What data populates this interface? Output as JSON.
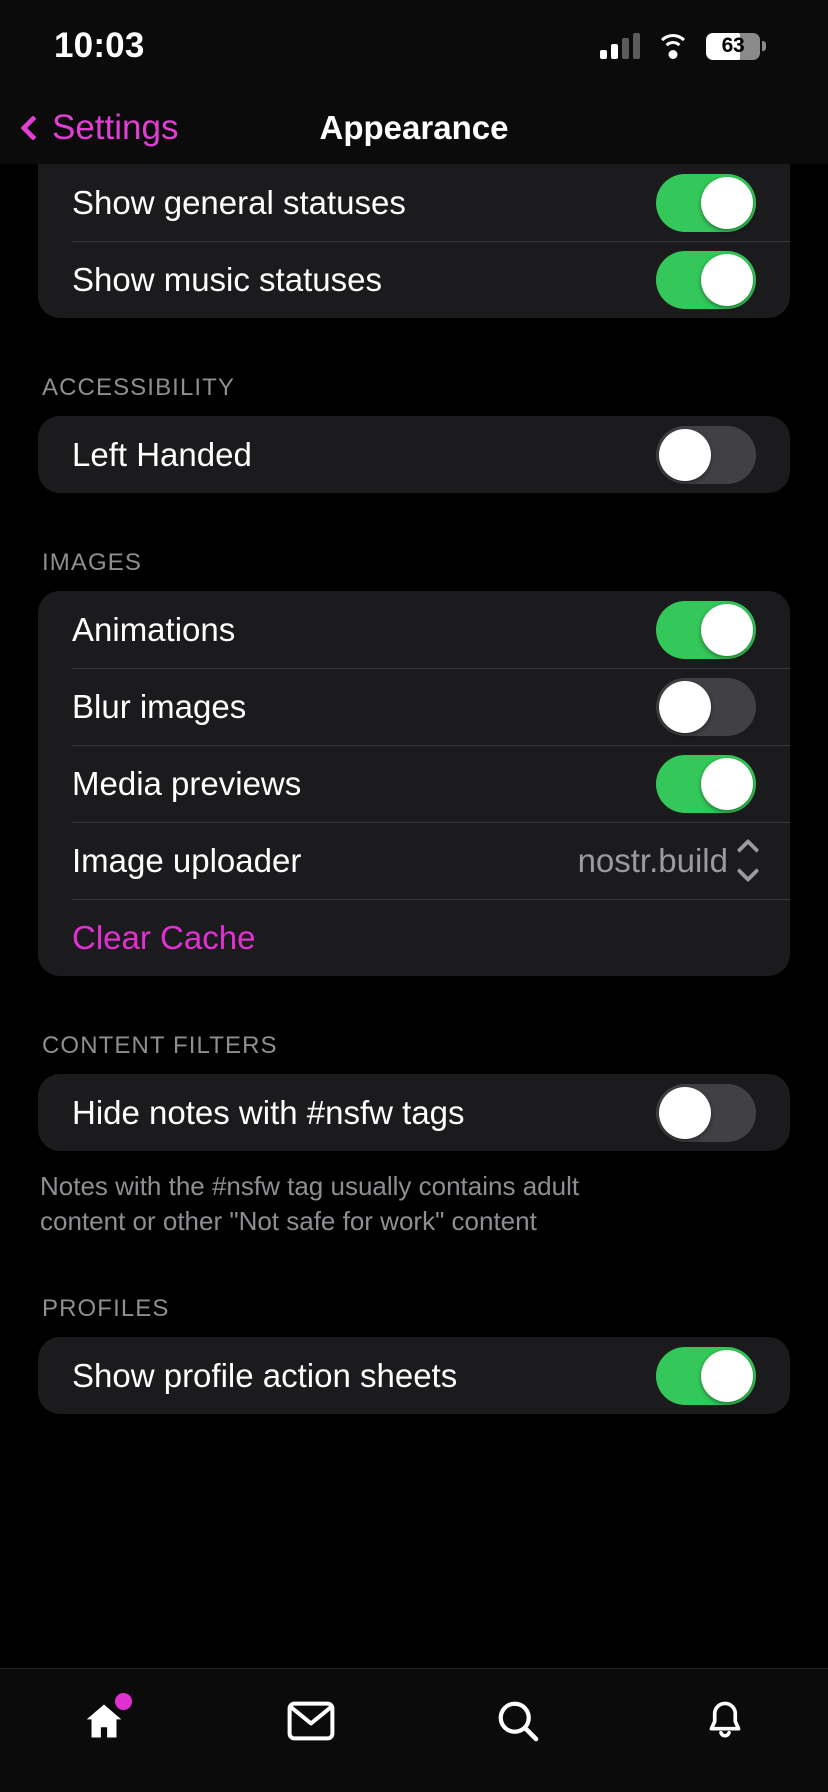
{
  "status_bar": {
    "time": "10:03",
    "battery_percent": "63",
    "battery_level": 63,
    "signal_icon": "cellular-bars-icon",
    "wifi_icon": "wifi-icon",
    "battery_icon": "battery-icon"
  },
  "nav": {
    "back_label": "Settings",
    "back_icon": "chevron-left-icon",
    "title": "Appearance"
  },
  "colors": {
    "accent": "#e130d2",
    "switch_on": "#34c759",
    "switch_off": "#414145",
    "card": "#1b1b1d",
    "background": "#000000",
    "secondary_text": "#8e8e93"
  },
  "sections": [
    {
      "header": "",
      "clipped": true,
      "rows": [
        {
          "label": "Show general statuses",
          "control": "switch",
          "value": "on"
        },
        {
          "label": "Show music statuses",
          "control": "switch",
          "value": "on"
        }
      ],
      "footnote": ""
    },
    {
      "header": "ACCESSIBILITY",
      "clipped": false,
      "rows": [
        {
          "label": "Left Handed",
          "control": "switch",
          "value": "off"
        }
      ],
      "footnote": ""
    },
    {
      "header": "IMAGES",
      "clipped": false,
      "rows": [
        {
          "label": "Animations",
          "control": "switch",
          "value": "on"
        },
        {
          "label": "Blur images",
          "control": "switch",
          "value": "off"
        },
        {
          "label": "Media previews",
          "control": "switch",
          "value": "on"
        },
        {
          "label": "Image uploader",
          "control": "picker",
          "value": "nostr.build"
        },
        {
          "label": "Clear Cache",
          "control": "none",
          "value": "",
          "accent": true
        }
      ],
      "footnote": ""
    },
    {
      "header": "CONTENT FILTERS",
      "clipped": false,
      "rows": [
        {
          "label": "Hide notes with #nsfw tags",
          "control": "switch",
          "value": "off"
        }
      ],
      "footnote": "Notes with the #nsfw tag usually contains adult content or other \"Not safe for work\" content"
    },
    {
      "header": "PROFILES",
      "clipped": false,
      "rows": [
        {
          "label": "Show profile action sheets",
          "control": "switch",
          "value": "on"
        }
      ],
      "footnote": ""
    }
  ],
  "tab_bar": {
    "items": [
      {
        "icon": "home-icon",
        "badge": true
      },
      {
        "icon": "mail-icon",
        "badge": false
      },
      {
        "icon": "search-icon",
        "badge": false
      },
      {
        "icon": "bell-icon",
        "badge": false
      }
    ]
  }
}
